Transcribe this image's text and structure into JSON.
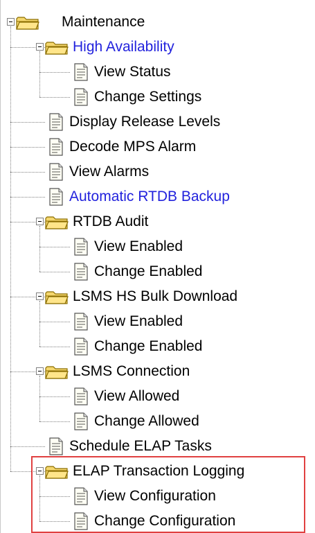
{
  "tree": {
    "nodes": [
      {
        "id": "maintenance",
        "label": "Maintenance",
        "type": "folder",
        "level": 0,
        "expanded": true,
        "link": false
      },
      {
        "id": "high-availability",
        "label": "High Availability",
        "type": "folder",
        "level": 1,
        "expanded": true,
        "link": true
      },
      {
        "id": "view-status",
        "label": "View Status",
        "type": "page",
        "level": 2,
        "link": false
      },
      {
        "id": "change-settings",
        "label": "Change Settings",
        "type": "page",
        "level": 2,
        "link": false
      },
      {
        "id": "display-release-levels",
        "label": "Display Release Levels",
        "type": "page",
        "level": 1,
        "link": false
      },
      {
        "id": "decode-mps-alarm",
        "label": "Decode MPS Alarm",
        "type": "page",
        "level": 1,
        "link": false
      },
      {
        "id": "view-alarms",
        "label": "View Alarms",
        "type": "page",
        "level": 1,
        "link": false
      },
      {
        "id": "automatic-rtdb-backup",
        "label": "Automatic RTDB Backup",
        "type": "page",
        "level": 1,
        "link": true
      },
      {
        "id": "rtdb-audit",
        "label": "RTDB Audit",
        "type": "folder",
        "level": 1,
        "expanded": true,
        "link": false
      },
      {
        "id": "rtdb-audit-view-enabled",
        "label": "View Enabled",
        "type": "page",
        "level": 2,
        "link": false
      },
      {
        "id": "rtdb-audit-change-enabled",
        "label": "Change Enabled",
        "type": "page",
        "level": 2,
        "link": false
      },
      {
        "id": "lsms-hs-bulk-download",
        "label": "LSMS HS Bulk Download",
        "type": "folder",
        "level": 1,
        "expanded": true,
        "link": false
      },
      {
        "id": "lsms-hs-view-enabled",
        "label": "View Enabled",
        "type": "page",
        "level": 2,
        "link": false
      },
      {
        "id": "lsms-hs-change-enabled",
        "label": "Change Enabled",
        "type": "page",
        "level": 2,
        "link": false
      },
      {
        "id": "lsms-connection",
        "label": "LSMS Connection",
        "type": "folder",
        "level": 1,
        "expanded": true,
        "link": false
      },
      {
        "id": "lsms-connection-view-allowed",
        "label": "View Allowed",
        "type": "page",
        "level": 2,
        "link": false
      },
      {
        "id": "lsms-connection-change-allowed",
        "label": "Change Allowed",
        "type": "page",
        "level": 2,
        "link": false
      },
      {
        "id": "schedule-elap-tasks",
        "label": "Schedule ELAP Tasks",
        "type": "page",
        "level": 1,
        "link": false
      },
      {
        "id": "elap-transaction-logging",
        "label": "ELAP Transaction Logging",
        "type": "folder",
        "level": 1,
        "expanded": true,
        "link": false
      },
      {
        "id": "view-configuration",
        "label": "View Configuration",
        "type": "page",
        "level": 2,
        "link": false
      },
      {
        "id": "change-configuration",
        "label": "Change Configuration",
        "type": "page",
        "level": 2,
        "link": false
      }
    ]
  },
  "colors": {
    "link": "#2222dd",
    "text": "#000000",
    "highlight_border": "#e04040",
    "folder_fill": "#f5d76e",
    "folder_stroke": "#8a6d00"
  }
}
